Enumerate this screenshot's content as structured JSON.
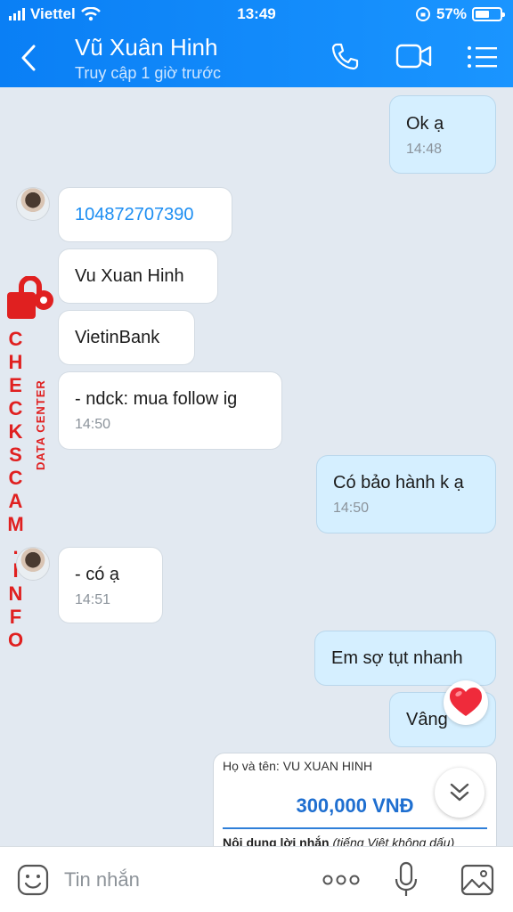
{
  "status_bar": {
    "carrier": "Viettel",
    "time": "13:49",
    "battery": "57%",
    "battery_level": 0.57
  },
  "header": {
    "title": "Vũ Xuân Hinh",
    "subtitle": "Truy cập 1 giờ trước"
  },
  "messages": [
    {
      "side": "out",
      "text": "Ok ạ",
      "time": "14:48"
    },
    {
      "side": "in",
      "text": "104872707390"
    },
    {
      "side": "in",
      "text": "Vu Xuan Hinh"
    },
    {
      "side": "in",
      "text": "VietinBank"
    },
    {
      "side": "in",
      "text": "- ndck: mua follow ig",
      "time": "14:50"
    },
    {
      "side": "out",
      "text": "Có bảo hành k ạ",
      "time": "14:50"
    },
    {
      "side": "in",
      "text": "- có ạ",
      "time": "14:51"
    },
    {
      "side": "out",
      "text": "Em sợ tụt nhanh"
    },
    {
      "side": "out",
      "text": "Vâng"
    }
  ],
  "transfer_card": {
    "name_line": "Họ và tên: VU XUAN HINH",
    "amount": "300,000 VNĐ",
    "note_label": "Nội dung lời nhắn",
    "note_hint": "(tiếng Việt không dấu)"
  },
  "watermark": {
    "brand": "CHECKSCAM.INFO",
    "sub": "DATA CENTER"
  },
  "composer": {
    "placeholder": "Tin nhắn"
  },
  "colors": {
    "header": "#0a7ff5",
    "incoming": "#ffffff",
    "outgoing": "#d5efff",
    "watermark": "#e02020"
  }
}
